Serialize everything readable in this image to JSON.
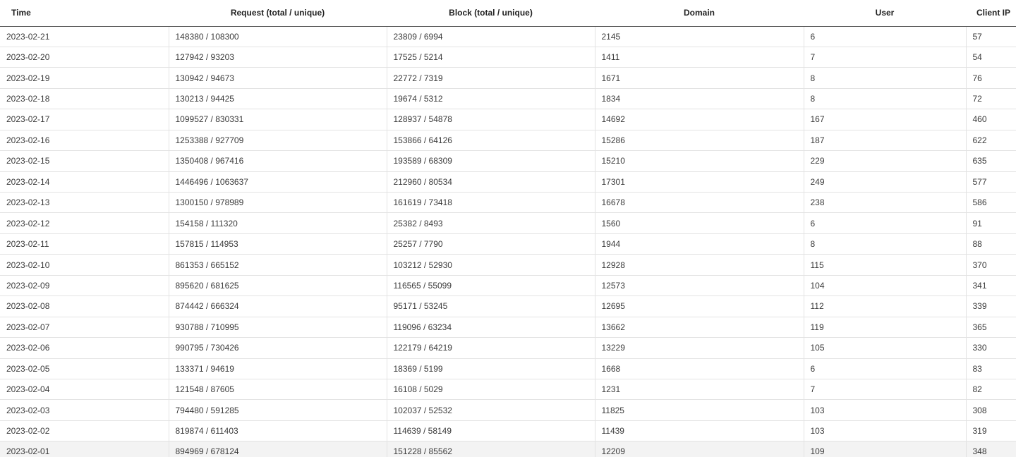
{
  "table": {
    "headers": {
      "time": "Time",
      "request": "Request (total / unique)",
      "block": "Block (total / unique)",
      "domain": "Domain",
      "user": "User",
      "client_ip": "Client IP"
    },
    "rows": [
      {
        "time": "2023-02-21",
        "request": "148380 / 108300",
        "block": "23809 / 6994",
        "domain": "2145",
        "user": "6",
        "client_ip": "57"
      },
      {
        "time": "2023-02-20",
        "request": "127942 / 93203",
        "block": "17525 / 5214",
        "domain": "1411",
        "user": "7",
        "client_ip": "54"
      },
      {
        "time": "2023-02-19",
        "request": "130942 / 94673",
        "block": "22772 / 7319",
        "domain": "1671",
        "user": "8",
        "client_ip": "76"
      },
      {
        "time": "2023-02-18",
        "request": "130213 / 94425",
        "block": "19674 / 5312",
        "domain": "1834",
        "user": "8",
        "client_ip": "72"
      },
      {
        "time": "2023-02-17",
        "request": "1099527 / 830331",
        "block": "128937 / 54878",
        "domain": "14692",
        "user": "167",
        "client_ip": "460"
      },
      {
        "time": "2023-02-16",
        "request": "1253388 / 927709",
        "block": "153866 / 64126",
        "domain": "15286",
        "user": "187",
        "client_ip": "622"
      },
      {
        "time": "2023-02-15",
        "request": "1350408 / 967416",
        "block": "193589 / 68309",
        "domain": "15210",
        "user": "229",
        "client_ip": "635"
      },
      {
        "time": "2023-02-14",
        "request": "1446496 / 1063637",
        "block": "212960 / 80534",
        "domain": "17301",
        "user": "249",
        "client_ip": "577"
      },
      {
        "time": "2023-02-13",
        "request": "1300150 / 978989",
        "block": "161619 / 73418",
        "domain": "16678",
        "user": "238",
        "client_ip": "586"
      },
      {
        "time": "2023-02-12",
        "request": "154158 / 111320",
        "block": "25382 / 8493",
        "domain": "1560",
        "user": "6",
        "client_ip": "91"
      },
      {
        "time": "2023-02-11",
        "request": "157815 / 114953",
        "block": "25257 / 7790",
        "domain": "1944",
        "user": "8",
        "client_ip": "88"
      },
      {
        "time": "2023-02-10",
        "request": "861353 / 665152",
        "block": "103212 / 52930",
        "domain": "12928",
        "user": "115",
        "client_ip": "370"
      },
      {
        "time": "2023-02-09",
        "request": "895620 / 681625",
        "block": "116565 / 55099",
        "domain": "12573",
        "user": "104",
        "client_ip": "341"
      },
      {
        "time": "2023-02-08",
        "request": "874442 / 666324",
        "block": "95171 / 53245",
        "domain": "12695",
        "user": "112",
        "client_ip": "339"
      },
      {
        "time": "2023-02-07",
        "request": "930788 / 710995",
        "block": "119096 / 63234",
        "domain": "13662",
        "user": "119",
        "client_ip": "365"
      },
      {
        "time": "2023-02-06",
        "request": "990795 / 730426",
        "block": "122179 / 64219",
        "domain": "13229",
        "user": "105",
        "client_ip": "330"
      },
      {
        "time": "2023-02-05",
        "request": "133371 / 94619",
        "block": "18369 / 5199",
        "domain": "1668",
        "user": "6",
        "client_ip": "83"
      },
      {
        "time": "2023-02-04",
        "request": "121548 / 87605",
        "block": "16108 / 5029",
        "domain": "1231",
        "user": "7",
        "client_ip": "82"
      },
      {
        "time": "2023-02-03",
        "request": "794480 / 591285",
        "block": "102037 / 52532",
        "domain": "11825",
        "user": "103",
        "client_ip": "308"
      },
      {
        "time": "2023-02-02",
        "request": "819874 / 611403",
        "block": "114639 / 58149",
        "domain": "11439",
        "user": "103",
        "client_ip": "319"
      },
      {
        "time": "2023-02-01",
        "request": "894969 / 678124",
        "block": "151228 / 85562",
        "domain": "12209",
        "user": "109",
        "client_ip": "348",
        "highlighted": true
      }
    ]
  }
}
